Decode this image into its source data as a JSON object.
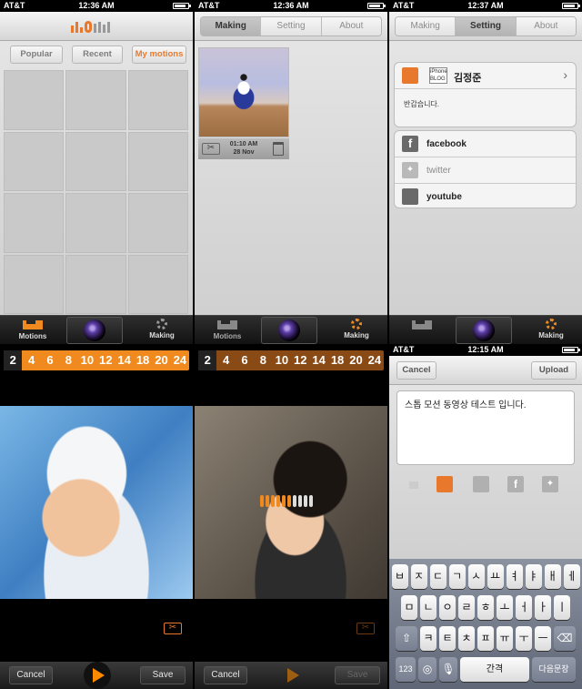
{
  "status": {
    "s1": {
      "carrier": "AT&T",
      "time": "12:36 AM"
    },
    "s2": {
      "carrier": "AT&T",
      "time": "12:36 AM"
    },
    "s3": {
      "carrier": "AT&T",
      "time": "12:37 AM"
    },
    "s4": {
      "carrier": "AT&T",
      "time": "12:15 AM"
    }
  },
  "segment_tabs": [
    "Making",
    "Setting",
    "About"
  ],
  "filters": [
    "Popular",
    "Recent",
    "My motions"
  ],
  "clip": {
    "time": "01:10 AM",
    "date": "28 Nov"
  },
  "account": {
    "badge_line1": "iPhone",
    "badge_line2": "BLOG",
    "name": "김정준",
    "greeting": "반갑습니다."
  },
  "social": [
    "facebook",
    "twitter",
    "youtube"
  ],
  "tabbar": {
    "motions": "Motions",
    "making": "Making"
  },
  "timeline": [
    "2",
    "4",
    "6",
    "8",
    "10",
    "12",
    "14",
    "18",
    "20",
    "24"
  ],
  "bottom": {
    "cancel": "Cancel",
    "save": "Save"
  },
  "upload": {
    "cancel": "Cancel",
    "upload": "Upload",
    "message": "스톱 모션 동영상 테스트 입니다."
  },
  "keyboard": {
    "row1": [
      "ㅂ",
      "ㅈ",
      "ㄷ",
      "ㄱ",
      "ㅅ",
      "ㅛ",
      "ㅕ",
      "ㅑ",
      "ㅐ",
      "ㅔ"
    ],
    "row2": [
      "ㅁ",
      "ㄴ",
      "ㅇ",
      "ㄹ",
      "ㅎ",
      "ㅗ",
      "ㅓ",
      "ㅏ",
      "ㅣ"
    ],
    "row3": [
      "ㅋ",
      "ㅌ",
      "ㅊ",
      "ㅍ",
      "ㅠ",
      "ㅜ",
      "ㅡ"
    ],
    "num": "123",
    "space": "간격",
    "return": "다음문장"
  },
  "colors": {
    "accent": "#e8792c",
    "progress": "#f08a1e"
  }
}
